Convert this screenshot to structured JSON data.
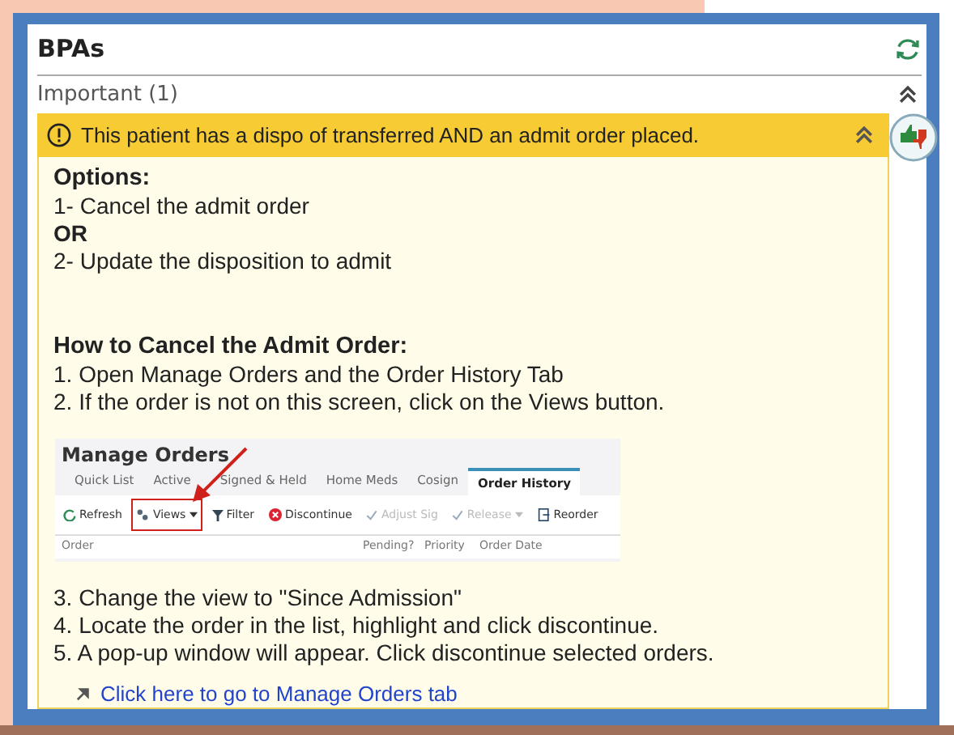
{
  "panel": {
    "title": "BPAs"
  },
  "section": {
    "label": "Important (1)",
    "expanded": true
  },
  "alert": {
    "message": "This patient has a dispo of transferred AND an admit order placed.",
    "expanded": true,
    "options_heading": "Options:",
    "options": [
      {
        "kind": "text",
        "text": "1- Cancel the admit order"
      },
      {
        "kind": "bold",
        "text": "OR"
      },
      {
        "kind": "text",
        "text": "2- Update the disposition to admit"
      }
    ],
    "howto_heading": "How to Cancel the Admit Order:",
    "steps_before": [
      "1. Open Manage Orders and the Order History Tab",
      "2. If the order is not on this screen, click on the Views button."
    ],
    "screenshot": {
      "title": "Manage Orders",
      "tabs": [
        {
          "label": "Quick List",
          "selected": false
        },
        {
          "label": "Active",
          "selected": false
        },
        {
          "label": "Signed & Held",
          "selected": false
        },
        {
          "label": "Home Meds",
          "selected": false
        },
        {
          "label": "Cosign",
          "selected": false
        },
        {
          "label": "Order History",
          "selected": true
        }
      ],
      "toolbar": [
        {
          "kind": "refresh",
          "label": "Refresh",
          "disabled": false,
          "highlighted": false
        },
        {
          "kind": "views",
          "label": "Views",
          "disabled": false,
          "highlighted": true
        },
        {
          "kind": "filter",
          "label": "Filter",
          "disabled": false,
          "highlighted": false
        },
        {
          "kind": "discontinue",
          "label": "Discontinue",
          "disabled": false,
          "highlighted": false
        },
        {
          "kind": "adjust",
          "label": "Adjust Sig",
          "disabled": true,
          "highlighted": false
        },
        {
          "kind": "release",
          "label": "Release",
          "disabled": true,
          "highlighted": false
        },
        {
          "kind": "reorder",
          "label": "Reorder",
          "disabled": false,
          "highlighted": false
        }
      ],
      "columns": [
        "Order",
        "Pending?",
        "Priority",
        "Order Date"
      ]
    },
    "steps_after": [
      "3. Change the view to \"Since Admission\"",
      "4. Locate the order in the list, highlight and click discontinue.",
      "5. A pop-up window will appear. Click discontinue selected orders."
    ],
    "link": "Click here to go to Manage Orders tab"
  }
}
